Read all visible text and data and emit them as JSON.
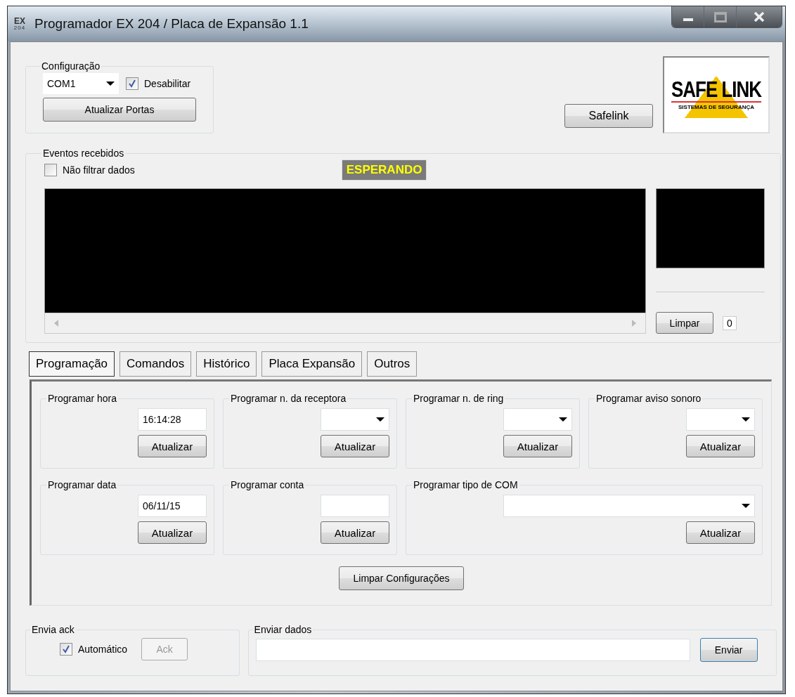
{
  "window": {
    "title": "Programador EX 204 / Placa de Expansão 1.1",
    "icon_text": [
      "EX",
      "204"
    ]
  },
  "configuracao": {
    "title": "Configuração",
    "port": "COM1",
    "disable": {
      "label": "Desabilitar",
      "checked": true
    },
    "refresh_button": "Atualizar Portas"
  },
  "safelink_button": "Safelink",
  "logo": {
    "name": "SAFE LINK",
    "tagline": "SISTEMAS DE SEGURANÇA"
  },
  "events": {
    "title": "Eventos recebidos",
    "no_filter": {
      "label": "Não filtrar dados",
      "checked": false
    },
    "status": "ESPERANDO",
    "clear_button": "Limpar",
    "count": "0"
  },
  "tabs": [
    {
      "label": "Programação",
      "selected": true
    },
    {
      "label": "Comandos",
      "selected": false
    },
    {
      "label": "Histórico",
      "selected": false
    },
    {
      "label": "Placa Expansão",
      "selected": false
    },
    {
      "label": "Outros",
      "selected": false
    }
  ],
  "groups": [
    {
      "title": "Programar hora",
      "kind": "text",
      "value": "16:14:28",
      "button": "Atualizar",
      "wide": false
    },
    {
      "title": "Programar n. da receptora",
      "kind": "select",
      "button": "Atualizar",
      "wide": false
    },
    {
      "title": "Programar n. de ring",
      "kind": "select",
      "button": "Atualizar",
      "wide": false
    },
    {
      "title": "Programar aviso sonoro",
      "kind": "select",
      "button": "Atualizar",
      "wide": false
    },
    {
      "title": "Programar data",
      "kind": "text",
      "value": "06/11/15",
      "button": "Atualizar",
      "wide": false
    },
    {
      "title": "Programar conta",
      "kind": "text",
      "button": "Atualizar",
      "wide": false
    },
    {
      "title": "Programar tipo de COM",
      "kind": "select",
      "button": "Atualizar",
      "wide": true
    }
  ],
  "clear_config_button": "Limpar Configurações",
  "ack": {
    "title": "Envia ack",
    "auto": {
      "label": "Automático",
      "checked": true
    },
    "button": "Ack",
    "button_disabled": true
  },
  "send": {
    "title": "Enviar dados",
    "button": "Enviar"
  }
}
